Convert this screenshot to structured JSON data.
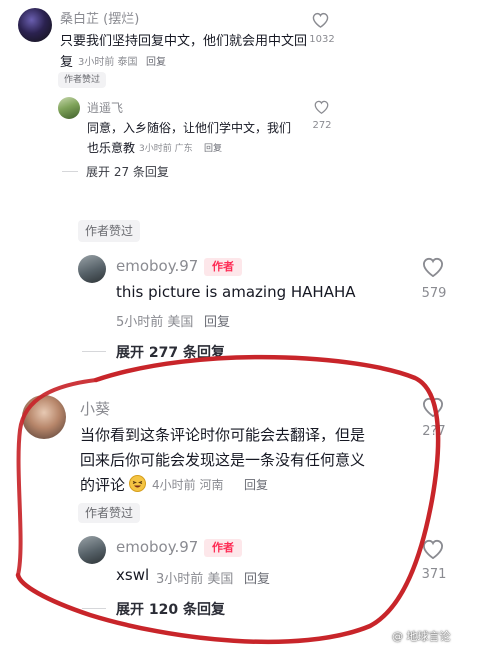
{
  "c1": {
    "name": "桑白芷 (摆烂)",
    "text_l1": "只要我们坚持回复中文，他们就会用中文回",
    "text_l2": "复",
    "meta": "3小时前 泰国",
    "reply": "回复",
    "likes": "1032",
    "author_liked": "作者赞过"
  },
  "c1r": {
    "name": "逍遥飞",
    "text_l1": "同意，入乡随俗，让他们学中文，我们",
    "text_l2": "也乐意教",
    "meta": "3小时前 广东",
    "reply": "回复",
    "likes": "272",
    "expand": "展开 27 条回复"
  },
  "c2": {
    "author_liked": "作者赞过"
  },
  "c2r": {
    "name": "emoboy.97",
    "author_tag": "作者",
    "text": "this picture is amazing HAHAHA",
    "meta": "5小时前 美国",
    "reply": "回复",
    "likes": "579",
    "expand": "展开 277 条回复"
  },
  "c3": {
    "name": "小葵",
    "text_l1": "当你看到这条评论时你可能会去翻译，但是",
    "text_l2": "回来后你可能会发现这是一条没有任何意义",
    "text_l3": "的评论",
    "meta": "4小时前 河南",
    "reply": "回复",
    "likes": "2?7",
    "author_liked": "作者赞过"
  },
  "c3r": {
    "name": "emoboy.97",
    "author_tag": "作者",
    "text": "xswl",
    "meta": "3小时前 美国",
    "reply": "回复",
    "likes": "371",
    "expand": "展开 120 条回复"
  },
  "watermark": "@ 地球言论",
  "colors": {
    "annotation_red": "#c8252a",
    "author_tag": "#fe2c55"
  }
}
